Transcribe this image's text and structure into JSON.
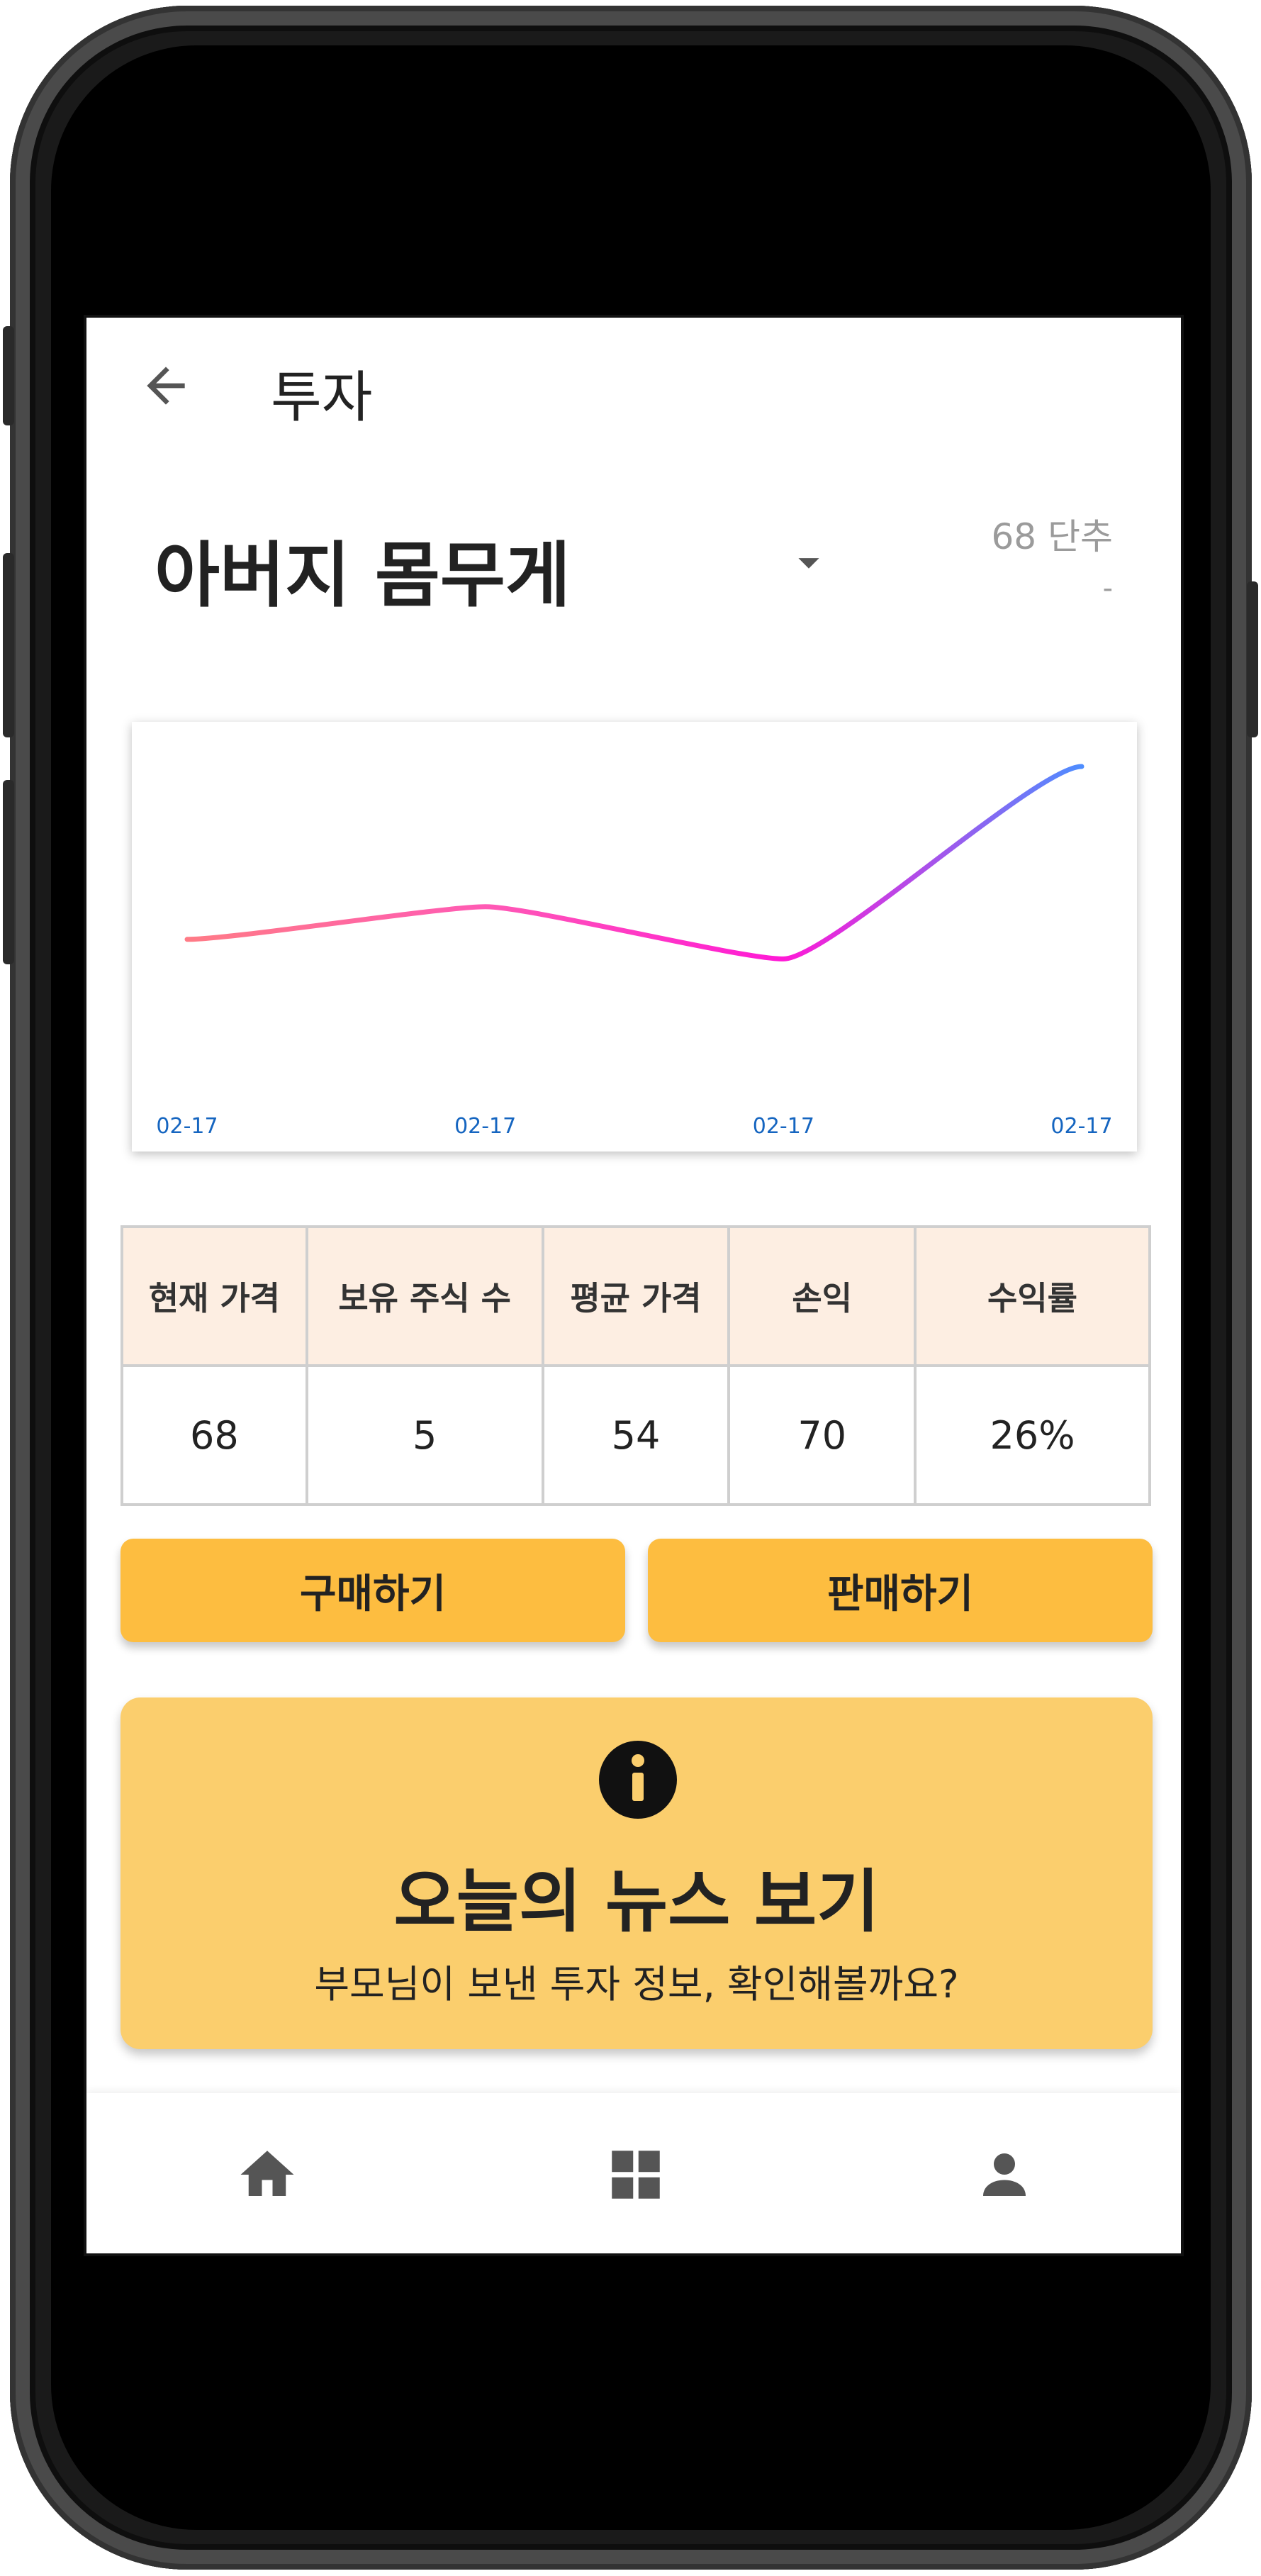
{
  "appbar": {
    "title": "투자",
    "back_icon": "arrow-back-icon"
  },
  "stock": {
    "name": "아버지 몸무게",
    "price_label": "68 단추",
    "change_label": "-",
    "dropdown_icon": "caret-down-icon"
  },
  "chart_data": {
    "type": "line",
    "x": [
      "02-17",
      "02-17",
      "02-17",
      "02-17"
    ],
    "series": [
      {
        "values": [
          42,
          52,
          36,
          95
        ]
      }
    ],
    "ylim": [
      0,
      100
    ],
    "grid": false,
    "line_gradient": [
      "#ff7b86",
      "#ff5ab4",
      "#ff19d6",
      "#4e8dff"
    ],
    "tick_color": "#1565c0"
  },
  "table": {
    "headers": [
      "현재 가격",
      "보유 주식 수",
      "평균 가격",
      "손익",
      "수익률"
    ],
    "values": [
      "68",
      "5",
      "54",
      "70",
      "26%"
    ]
  },
  "actions": {
    "buy_label": "구매하기",
    "sell_label": "판매하기"
  },
  "news": {
    "icon": "info-icon",
    "title": "오늘의 뉴스 보기",
    "subtitle": "부모님이 보낸 투자 정보, 확인해볼까요?"
  },
  "nav": {
    "items": [
      {
        "icon": "home-icon"
      },
      {
        "icon": "grid-icon"
      },
      {
        "icon": "person-icon"
      }
    ]
  },
  "colors": {
    "accent": "#fdbd40",
    "news_bg": "#fbce6d",
    "table_header_bg": "#fdeee2"
  }
}
